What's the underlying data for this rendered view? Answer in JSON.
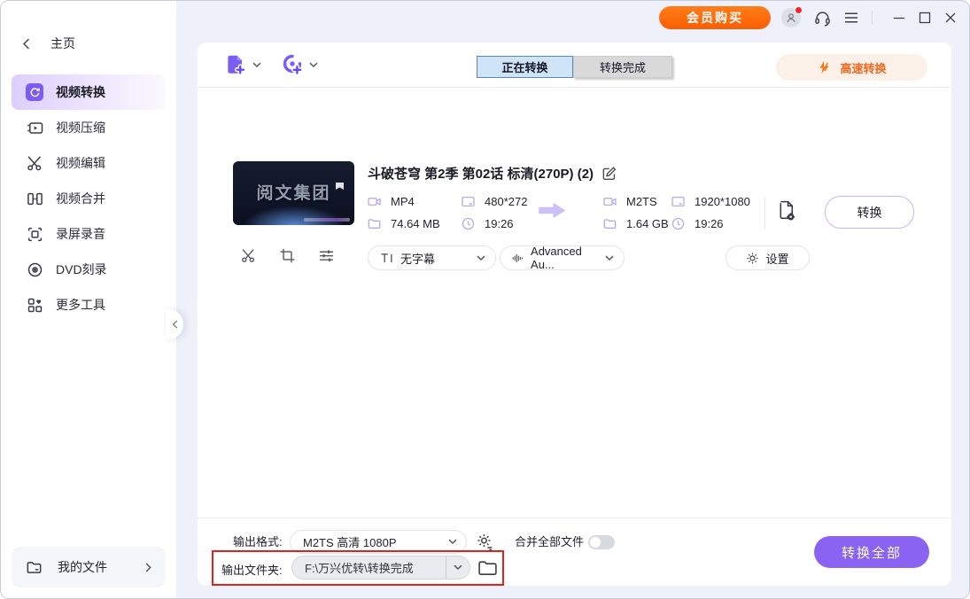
{
  "colors": {
    "accent_purple": "#7b5bf3",
    "convert_all_purple": "#8a63f3",
    "buy_orange": "#fa5e02",
    "speed_orange_text": "#f2661e",
    "speed_pill_bg": "#fcf1e8",
    "lavender_bg": "#eef1fa",
    "active_tab_bg": "#cfe4f7",
    "active_tab_border": "#5b87bd",
    "annotation_red": "#e0241c"
  },
  "titlebar": {
    "buy_button": "会员购买"
  },
  "sidebar": {
    "home_label": "主页",
    "items": [
      {
        "label": "视频转换",
        "active": true
      },
      {
        "label": "视频压缩",
        "active": false
      },
      {
        "label": "视频编辑",
        "active": false
      },
      {
        "label": "视频合并",
        "active": false
      },
      {
        "label": "录屏录音",
        "active": false
      },
      {
        "label": "DVD刻录",
        "active": false
      },
      {
        "label": "更多工具",
        "active": false
      }
    ],
    "my_files_label": "我的文件"
  },
  "toolbar": {
    "tab_converting": "正在转换",
    "tab_finished": "转换完成",
    "speed_label": "高速转换"
  },
  "file": {
    "title": "斗破苍穹 第2季 第02话 标清(270P) (2)",
    "thumbnail_text": "阅文集团",
    "source": {
      "format": "MP4",
      "size": "74.64 MB",
      "resolution": "480*272",
      "duration": "19:26"
    },
    "target": {
      "format": "M2TS",
      "size": "1.64 GB",
      "resolution": "1920*1080",
      "duration": "19:26"
    },
    "convert_button": "转换",
    "subtitle_dropdown": "无字幕",
    "audio_dropdown": "Advanced Au...",
    "settings_button": "设置"
  },
  "footer": {
    "output_format_label": "输出格式:",
    "output_format_value": "M2TS 高清 1080P",
    "merge_label": "合并全部文件",
    "merge_enabled": false,
    "output_folder_label": "输出文件夹:",
    "output_folder_value": "F:\\万兴优转\\转换完成",
    "convert_all_button": "转换全部"
  }
}
